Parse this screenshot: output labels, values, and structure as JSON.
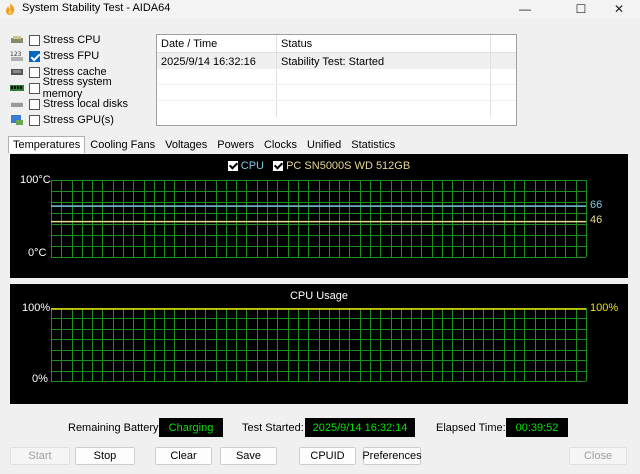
{
  "window": {
    "title": "System Stability Test - AIDA64",
    "min": "—",
    "max": "☐",
    "close": "✕"
  },
  "stress": [
    {
      "label": "Stress CPU",
      "checked": false,
      "icon": "cpu-chip-icon"
    },
    {
      "label": "Stress FPU",
      "checked": true,
      "icon": "fpu-123-icon"
    },
    {
      "label": "Stress cache",
      "checked": false,
      "icon": "cache-chip-icon"
    },
    {
      "label": "Stress system memory",
      "checked": false,
      "icon": "memory-module-icon"
    },
    {
      "label": "Stress local disks",
      "checked": false,
      "icon": "hard-disk-icon"
    },
    {
      "label": "Stress GPU(s)",
      "checked": false,
      "icon": "gpu-monitor-icon"
    }
  ],
  "log": {
    "headers": [
      "Date / Time",
      "Status"
    ],
    "rows": [
      {
        "date": "2025/9/14 16:32:16",
        "status": "Stability Test: Started"
      }
    ]
  },
  "tabs": [
    "Temperatures",
    "Cooling Fans",
    "Voltages",
    "Powers",
    "Clocks",
    "Unified",
    "Statistics"
  ],
  "temperature_graph": {
    "legend": [
      {
        "label": "CPU",
        "color": "#7ec8e3"
      },
      {
        "label": "PC SN5000S WD 512GB",
        "color": "#e8d890"
      }
    ],
    "ymax_label": "100°C",
    "ymin_label": "0°C",
    "current_values": [
      {
        "label": "66",
        "color": "#7ec8e3"
      },
      {
        "label": "46",
        "color": "#e8d890"
      }
    ]
  },
  "cpu_graph": {
    "title": "CPU Usage",
    "ymax_label": "100%",
    "ymin_label": "0%",
    "current_value": "100%",
    "value_color": "#e8e000"
  },
  "status": {
    "battery_label": "Remaining Battery:",
    "battery_value": "Charging",
    "started_label": "Test Started:",
    "started_value": "2025/9/14 16:32:14",
    "elapsed_label": "Elapsed Time:",
    "elapsed_value": "00:39:52"
  },
  "buttons": {
    "start": "Start",
    "stop": "Stop",
    "clear": "Clear",
    "save": "Save",
    "cpuid": "CPUID",
    "preferences": "Preferences",
    "close": "Close"
  },
  "colors": {
    "grid": "#1e8f1e",
    "graph_bg": "#000000",
    "status_text": "#00e000"
  }
}
